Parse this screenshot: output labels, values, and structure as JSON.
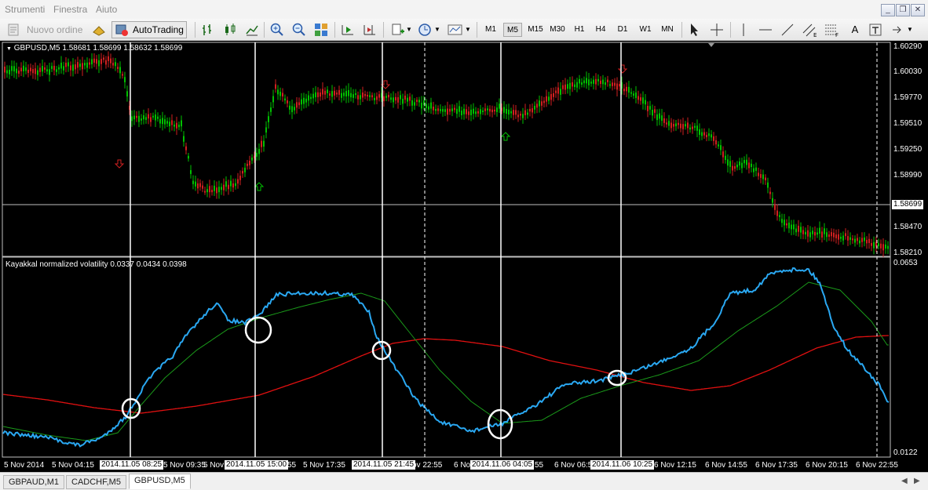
{
  "menu": {
    "items": [
      "Strumenti",
      "Finestra",
      "Aiuto"
    ]
  },
  "toolbar": {
    "new_order_label": "Nuovo ordine",
    "autotrading_label": "AutoTrading",
    "timeframes": [
      "M1",
      "M5",
      "M15",
      "M30",
      "H1",
      "H4",
      "D1",
      "W1",
      "MN"
    ],
    "active_timeframe": "M5"
  },
  "main_chart": {
    "header": "GBPUSD,M5  1.58681 1.58699 1.58632 1.58699",
    "price_labels": [
      "1.60290",
      "1.60030",
      "1.59770",
      "1.59510",
      "1.59250",
      "1.58990",
      "1.58470",
      "1.58210"
    ],
    "current_price": "1.58699"
  },
  "indicator": {
    "header": "Kayakkal normalized volatility 0.0337 0.0434 0.0398",
    "scale_top": "0.0653",
    "scale_bottom": "0.0122"
  },
  "time_axis": {
    "labels": [
      "5 Nov 2014",
      "5 Nov 04:15",
      "5 Nov 09:35",
      "5 Nov 17:35",
      "6 Nov 06:5",
      "6 Nov 12:15",
      "6 Nov 14:55",
      "6 Nov 17:35",
      "6 Nov 20:15",
      "6 Nov 22:55"
    ],
    "fragments": [
      "5 Nov",
      "55",
      "ov 22:55",
      "6 No",
      "55"
    ],
    "highlight_times": [
      "2014.11.05 08:25",
      "2014.11.05 15:00",
      "2014.11.05 21:45",
      "2014.11.06 04:05",
      "2014.11.06 10:25"
    ]
  },
  "tabs": [
    "GBPAUD,M1",
    "CADCHF,M5",
    "GBPUSD,M5"
  ],
  "active_tab": "GBPUSD,M5",
  "colors": {
    "up_candle": "#00c000",
    "down_candle": "#d02020",
    "vol_line": "#2aa8f2",
    "slow_line": "#e01010",
    "mid_line": "#1a9a1a"
  }
}
